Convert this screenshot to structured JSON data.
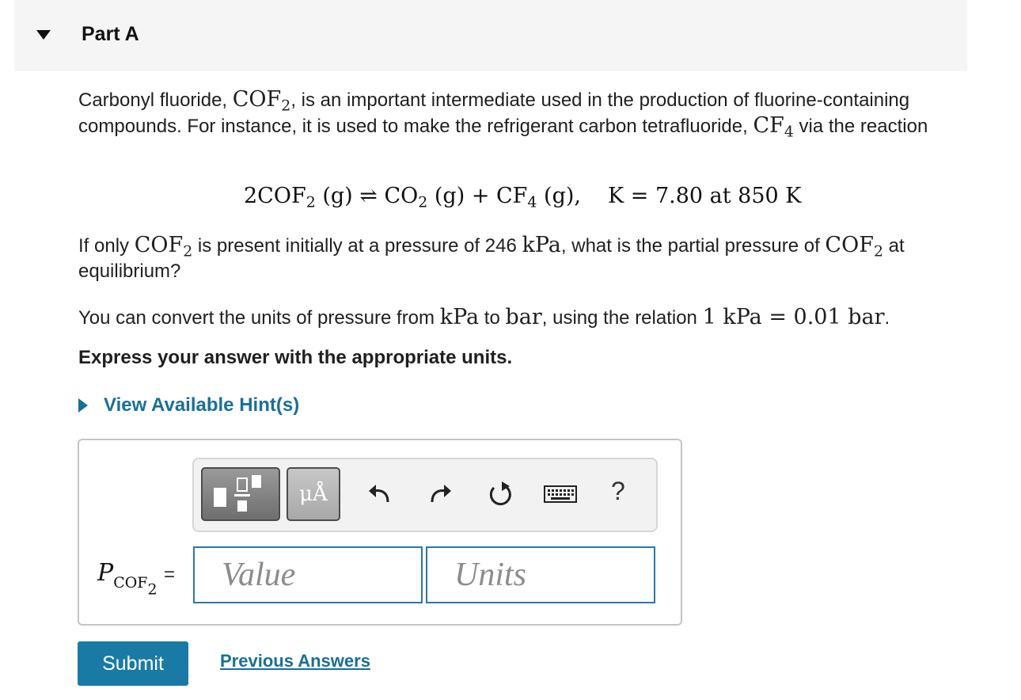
{
  "header": {
    "title": "Part A"
  },
  "question": {
    "p1_a": "Carbonyl fluoride, ",
    "p1_b": ", is an important intermediate used in the production of fluorine-containing compounds. For instance, it is used to make the refrigerant carbon tetrafluoride, ",
    "p1_c": " via the reaction",
    "cof": "COF",
    "cf": "CF",
    "two": "2",
    "four": "4",
    "eq_lhs": "2COF",
    "eq_g1": " (g) ⇌ CO",
    "eq_g2": " (g) + CF",
    "eq_g3": " (g),",
    "eq_k": "K = 7.80 at 850 K",
    "p2_a": "If only ",
    "p2_b": " is present initially at a pressure of 246 ",
    "p2_c": ", what is the partial pressure of ",
    "p2_d": " at equilibrium?",
    "kpa": "kPa",
    "p3_a": "You can convert the units of pressure from ",
    "p3_b": " to ",
    "p3_c": ", using the relation ",
    "p3_rel": "1 kPa = 0.01 bar",
    "p3_end": ".",
    "bar": "bar",
    "instruction": "Express your answer with the appropriate units."
  },
  "hint": {
    "label": "View Available Hint(s)"
  },
  "toolbar": {
    "units_label": "μÅ",
    "icons": [
      "templates-icon",
      "units-icon",
      "undo-icon",
      "redo-icon",
      "reset-icon",
      "keyboard-icon",
      "help-icon"
    ],
    "help_label": "?"
  },
  "answer": {
    "label_p": "P",
    "label_sub": "COF",
    "label_sub2": "2",
    "equals": "=",
    "value_placeholder": "Value",
    "units_placeholder": "Units"
  },
  "actions": {
    "submit_label": "Submit",
    "previous_label": "Previous Answers"
  }
}
